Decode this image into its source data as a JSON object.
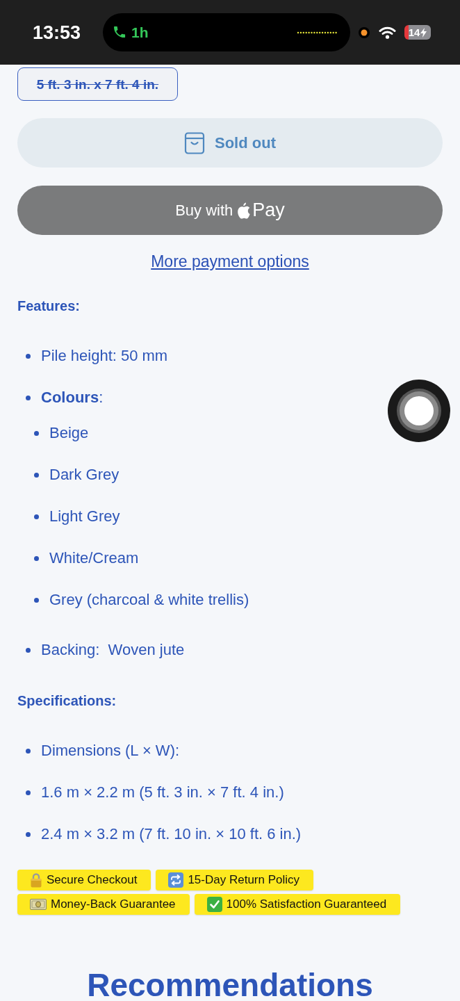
{
  "status_bar": {
    "time": "13:53",
    "call_duration": "1h",
    "battery": "14"
  },
  "variant": {
    "label": "5 ft. 3 in. x 7 ft. 4 in.",
    "selected": true,
    "available": false
  },
  "sold_out_button": {
    "label": "Sold out",
    "disabled": true
  },
  "express_button": {
    "label": "Buy with",
    "wordmark": "Pay"
  },
  "more_payment_link": "More payment options",
  "sections": [
    {
      "title": "Features:",
      "items": [
        {
          "text": "Pile height: 50 mm"
        },
        {
          "text": "**Colours**:",
          "children": [
            {
              "text": "Beige"
            },
            {
              "text": "Dark Grey"
            },
            {
              "text": "Light Grey"
            },
            {
              "text": "White/Cream"
            },
            {
              "text": "Grey (charcoal & white trellis)"
            }
          ]
        },
        {
          "text": "Backing:  Woven jute"
        }
      ]
    },
    {
      "title": "Specifications:",
      "items": [
        {
          "text": "Dimensions (L × W):"
        },
        {
          "text": "1.6 m × 2.2 m (5 ft. 3 in. × 7 ft. 4 in.)"
        },
        {
          "text": "2.4 m × 3.2 m (7 ft. 10 in. × 10 ft. 6 in.)"
        }
      ]
    }
  ],
  "badges": [
    {
      "kind": "lock",
      "text": "Secure Checkout"
    },
    {
      "kind": "repeat",
      "text": "15-Day Return Policy"
    },
    {
      "kind": "money",
      "text": "Money-Back Guarantee"
    },
    {
      "kind": "check",
      "text": "100% Satisfaction Guaranteed"
    }
  ],
  "recommendations_title": "Recommendations"
}
